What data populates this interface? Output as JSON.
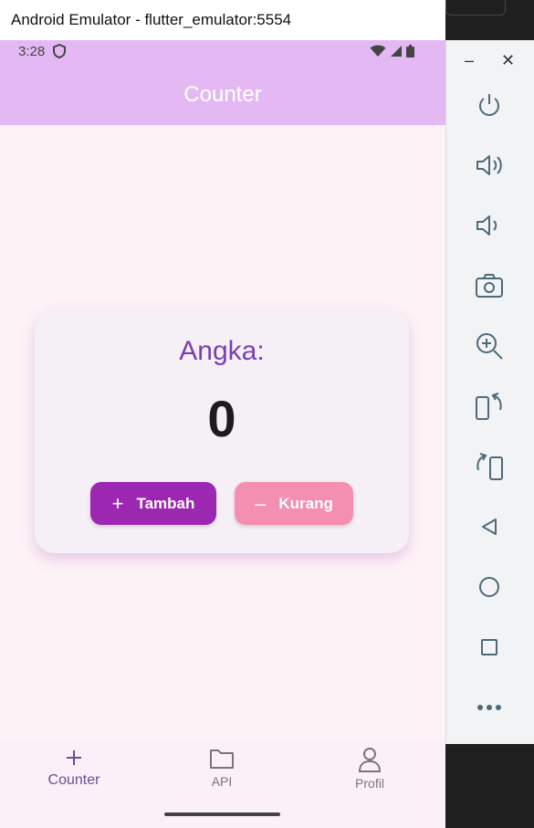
{
  "window": {
    "title": "Android Emulator - flutter_emulator:5554"
  },
  "statusbar": {
    "time": "3:28"
  },
  "appbar": {
    "title": "Counter"
  },
  "counter": {
    "label": "Angka:",
    "value": "0"
  },
  "buttons": {
    "add_label": "Tambah",
    "sub_label": "Kurang"
  },
  "nav": {
    "items": [
      {
        "label": "Counter",
        "icon": "plus-icon",
        "active": true
      },
      {
        "label": "API",
        "icon": "folder-icon"
      },
      {
        "label": "Profil",
        "icon": "person-icon"
      }
    ]
  },
  "side_panel": {
    "icons": [
      "power-icon",
      "volume-up-icon",
      "volume-down-icon",
      "camera-icon",
      "zoom-in-icon",
      "rotate-left-icon",
      "rotate-right-icon",
      "back-icon",
      "home-icon",
      "overview-icon",
      "more-icon"
    ]
  },
  "colors": {
    "appbar": "#e4b9f3",
    "add_button": "#9c27b0",
    "sub_button": "#f48fb1",
    "label": "#7b3fb0"
  }
}
